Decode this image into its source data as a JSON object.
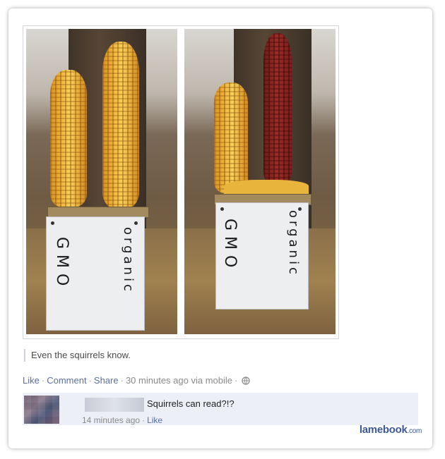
{
  "post": {
    "caption": "Even the squirrels know.",
    "actions": {
      "like": "Like",
      "comment": "Comment",
      "share": "Share",
      "timestamp": "30 minutes ago via mobile"
    }
  },
  "photo": {
    "left_sign": {
      "gmo": "GMO",
      "organic": "organic"
    },
    "right_sign": {
      "gmo": "GMO",
      "organic": "organic"
    }
  },
  "comment": {
    "text": "Squirrels can read?!?",
    "meta_time": "14 minutes ago",
    "meta_like": "Like"
  },
  "watermark": {
    "brand": "lamebook",
    "tld": ".com"
  },
  "colors": {
    "link": "#5a6fa0",
    "brand": "#3b5998",
    "comment_bg": "#eceff5"
  },
  "icons": {
    "audience": "globe-icon"
  }
}
